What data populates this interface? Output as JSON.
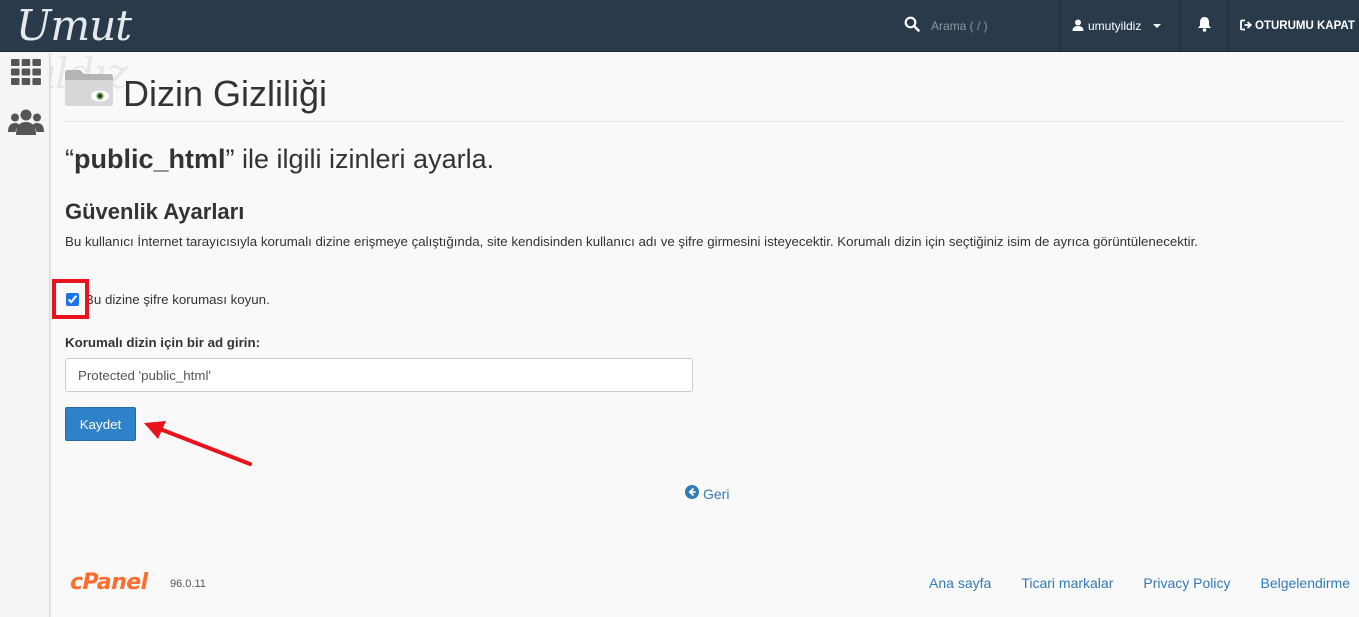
{
  "header": {
    "logo_text": "Umut Yıldız",
    "search_placeholder": "Arama ( / )",
    "username": "umutyildiz",
    "logout_label": "OTURUMU KAPAT"
  },
  "sidebar": {
    "items": [
      {
        "icon": "grid-icon"
      },
      {
        "icon": "users-icon"
      }
    ]
  },
  "page": {
    "title": "Dizin Gizliliği",
    "subtitle_open": "“",
    "subtitle_dir": "public_html",
    "subtitle_rest": "” ile ilgili izinleri ayarla.",
    "section_title": "Güvenlik Ayarları",
    "description": "Bu kullanıcı İnternet tarayıcısıyla korumalı dizine erişmeye çalıştığında, site kendisinden kullanıcı adı ve şifre girmesini isteyecektir. Korumalı dizin için seçtiğiniz isim de ayrıca görüntülenecektir.",
    "checkbox_label": "Bu dizine şifre koruması koyun.",
    "checkbox_checked": true,
    "field_label": "Korumalı dizin için bir ad girin:",
    "field_value": "Protected 'public_html'",
    "save_label": "Kaydet",
    "back_label": "Geri"
  },
  "footer": {
    "brand": "cPanel",
    "version": "96.0.11",
    "links": [
      "Ana sayfa",
      "Ticari markalar",
      "Privacy Policy",
      "Belgelendirme"
    ]
  },
  "colors": {
    "topbar": "#293a4a",
    "primary": "#2e82c9",
    "link": "#337ab7",
    "annotation": "#e8131d",
    "cpanel": "#ff6c2c"
  }
}
